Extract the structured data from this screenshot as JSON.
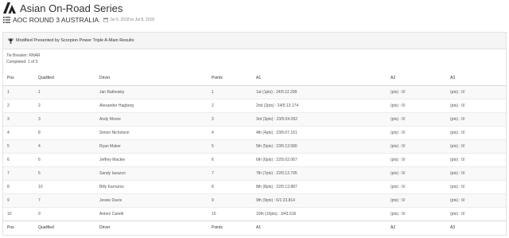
{
  "app": {
    "title": "Asian On-Road Series",
    "logo_icon": "series-logo-icon"
  },
  "event": {
    "title": "AOC ROUND 3 AUSTRALIA",
    "dates": "Jul 6, 2018 to Jul 8, 2018"
  },
  "panel": {
    "title": "Modified Presented by Scorpion Power Triple A-Main Results",
    "tie_breaker": "Tie Breaker: RNAR",
    "completed": "Completed: 1 of 3"
  },
  "table": {
    "headers": {
      "pos": "Pos",
      "qualified": "Qualified",
      "driver": "Driver",
      "points": "Points",
      "a1": "A1",
      "a2": "A2",
      "a3": "A3"
    },
    "rows": [
      {
        "pos": "1",
        "qualified": "1",
        "driver": "Jan Ratheisky",
        "points": "1",
        "a1": "1st (1pts) : 24/5:12.299",
        "a2": "(pts) : 0/",
        "a3": "(pts) : 0/"
      },
      {
        "pos": "2",
        "qualified": "2",
        "driver": "Alexander Hagberg",
        "points": "2",
        "a1": "2nd (2pts) : 24/5:13.174",
        "a2": "(pts) : 0/",
        "a3": "(pts) : 0/"
      },
      {
        "pos": "3",
        "qualified": "3",
        "driver": "Andy Moore",
        "points": "3",
        "a1": "3rd (3pts) : 23/5:04.092",
        "a2": "(pts) : 0/",
        "a3": "(pts) : 0/"
      },
      {
        "pos": "4",
        "qualified": "8",
        "driver": "Simon Nicholson",
        "points": "4",
        "a1": "4th (4pts) : 23/5:07.161",
        "a2": "(pts) : 0/",
        "a3": "(pts) : 0/"
      },
      {
        "pos": "5",
        "qualified": "4",
        "driver": "Ryan Maker",
        "points": "5",
        "a1": "5th (5pts) : 23/5:13.580",
        "a2": "(pts) : 0/",
        "a3": "(pts) : 0/"
      },
      {
        "pos": "6",
        "qualified": "6",
        "driver": "Jeffrey Mackie",
        "points": "6",
        "a1": "6th (6pts) : 22/5:02.067",
        "a2": "(pts) : 0/",
        "a3": "(pts) : 0/"
      },
      {
        "pos": "7",
        "qualified": "5",
        "driver": "Sandy Iavazzo",
        "points": "7",
        "a1": "7th (7pts) : 22/5:12.795",
        "a2": "(pts) : 0/",
        "a3": "(pts) : 0/"
      },
      {
        "pos": "8",
        "qualified": "10",
        "driver": "Billy Karnaros",
        "points": "8",
        "a1": "8th (8pts) : 22/5:13.887",
        "a2": "(pts) : 0/",
        "a3": "(pts) : 0/"
      },
      {
        "pos": "9",
        "qualified": "7",
        "driver": "Jessie Davis",
        "points": "9",
        "a1": "9th (9pts) : 6/1:23.814",
        "a2": "(pts) : 0/",
        "a3": "(pts) : 0/"
      },
      {
        "pos": "10",
        "qualified": "9",
        "driver": "Antoni Caretti",
        "points": "10",
        "a1": "10th (10pts) : 3/43.516",
        "a2": "(pts) : 0/",
        "a3": "(pts) : 0/"
      }
    ]
  },
  "colors": {
    "text": "#333333",
    "muted": "#888888",
    "panel_heading_bg": "#f5f5f5",
    "border": "#e2e2e2",
    "stripe": "#f9f9f9"
  }
}
